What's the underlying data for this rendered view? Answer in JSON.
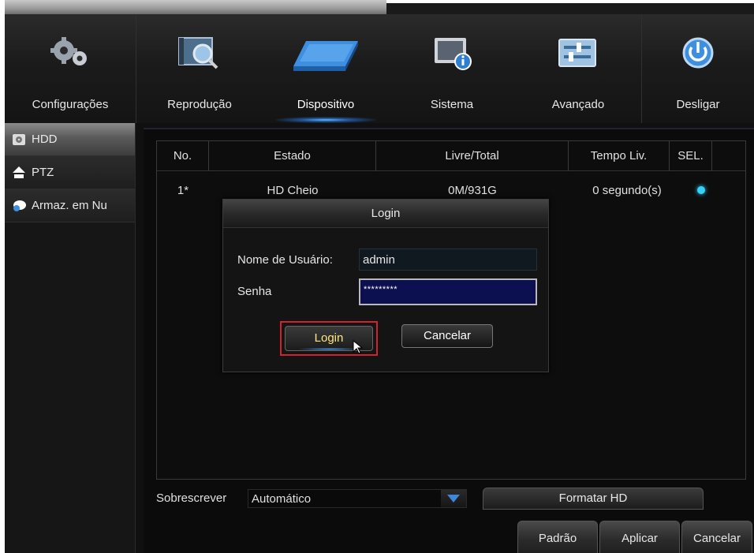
{
  "menu": {
    "items": [
      {
        "label": "Configurações",
        "icon": "gears-icon"
      },
      {
        "label": "Reprodução",
        "icon": "playback-search-icon"
      },
      {
        "label": "Dispositivo",
        "icon": "hard-drive-icon"
      },
      {
        "label": "Sistema",
        "icon": "system-info-icon"
      },
      {
        "label": "Avançado",
        "icon": "advanced-settings-icon"
      },
      {
        "label": "Desligar",
        "icon": "power-icon"
      }
    ],
    "active_index": 2
  },
  "sidebar": {
    "items": [
      {
        "label": "HDD",
        "icon": "hdd-icon"
      },
      {
        "label": "PTZ",
        "icon": "ptz-camera-icon"
      },
      {
        "label": "Armaz. em Nu",
        "icon": "cloud-storage-icon"
      }
    ],
    "active_index": 0
  },
  "table": {
    "columns": [
      "No.",
      "Estado",
      "Livre/Total",
      "Tempo Liv.",
      "SEL."
    ],
    "rows": [
      {
        "no": "1*",
        "estado": "HD Cheio",
        "livre_total": "0M/931G",
        "tempo": "0 segundo(s)",
        "selected": true
      }
    ]
  },
  "overwrite": {
    "label": "Sobrescrever",
    "value": "Automático"
  },
  "format_button": "Formatar HD",
  "footer_buttons": [
    "Padrão",
    "Aplicar",
    "Cancelar"
  ],
  "login_dialog": {
    "title": "Login",
    "username_label": "Nome de Usuário:",
    "username_value": "admin",
    "password_label": "Senha",
    "password_value": "*********",
    "login_button": "Login",
    "cancel_button": "Cancelar"
  },
  "colors": {
    "accent_blue": "#3e87d8",
    "sel_dot": "#36d0ff",
    "highlight_border": "#d0232e",
    "login_text": "#ffe680"
  }
}
